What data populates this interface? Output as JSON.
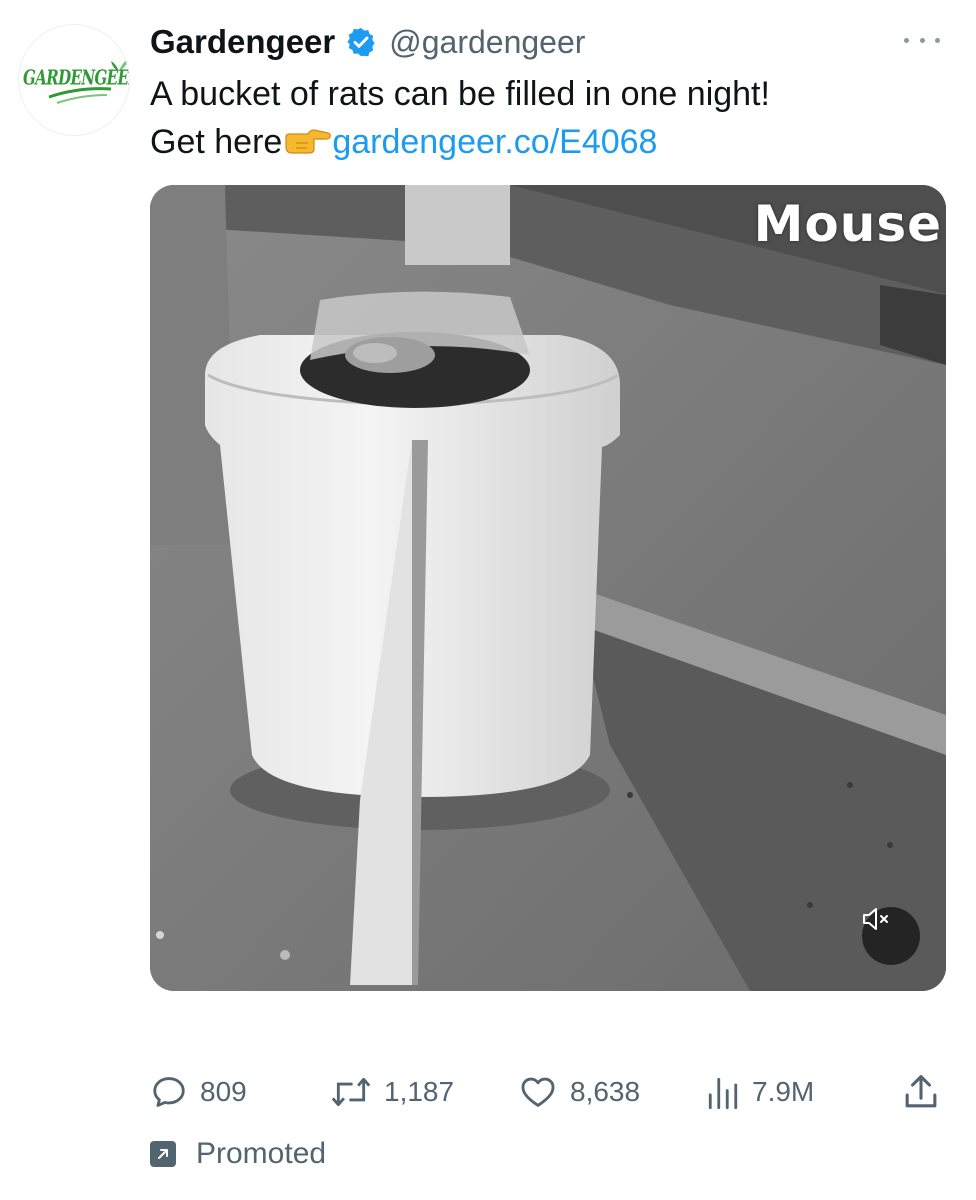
{
  "tweet": {
    "avatar_logo_text": "GARDENGEER",
    "display_name": "Gardengeer",
    "handle": "@gardengeer",
    "text_line_1": "A bucket of rats can be filled in one night!",
    "text_line_2_prefix": "Get here",
    "link": "gardengeer.co/E4068",
    "media": {
      "overlay_label": "Mouse",
      "muted": true
    },
    "icons": {
      "verified": "verified-badge-icon",
      "more": "more-horizontal-icon",
      "reply": "reply-icon",
      "retweet": "retweet-icon",
      "like": "heart-icon",
      "views": "views-icon",
      "share": "share-icon",
      "mute": "muted-speaker-icon",
      "promoted": "promoted-arrow-icon",
      "emoji": "pointing-right-emoji"
    }
  },
  "metrics": {
    "replies": "809",
    "retweets": "1,187",
    "likes": "8,638",
    "views": "7.9M"
  },
  "promoted_label": "Promoted",
  "colors": {
    "link": "#1d9bf0",
    "secondary_text": "#536471",
    "verified": "#1d9bf0",
    "brand_green": "#2e9a34"
  }
}
